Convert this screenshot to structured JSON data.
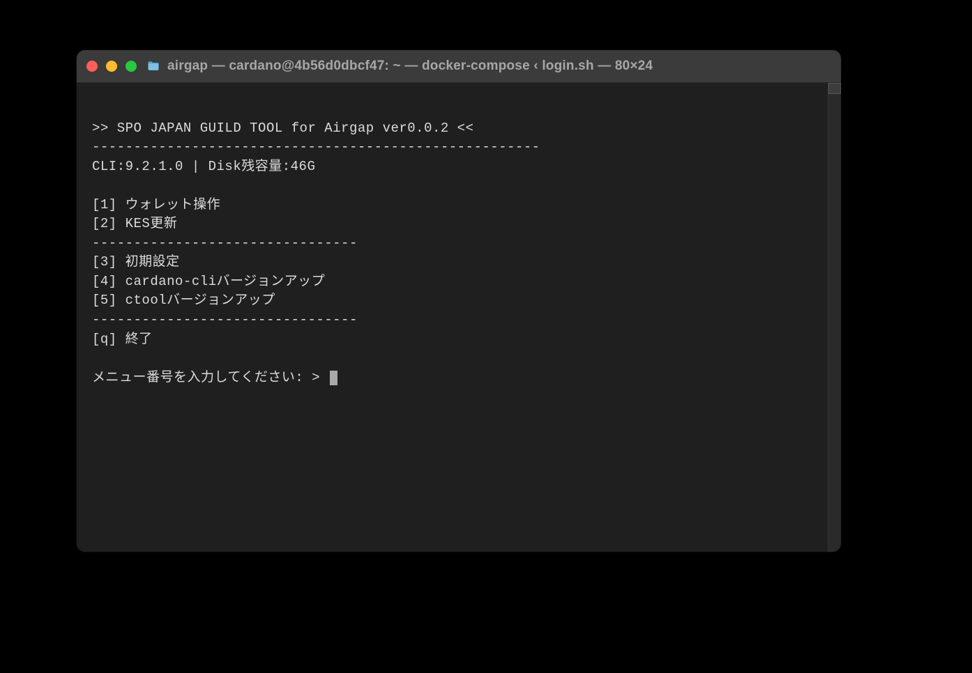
{
  "window": {
    "title": "airgap — cardano@4b56d0dbcf47: ~ — docker-compose ‹ login.sh — 80×24"
  },
  "terminal": {
    "header_line": ">> SPO JAPAN GUILD TOOL for Airgap ver0.0.2 <<",
    "rule_long": "------------------------------------------------------",
    "status_line": "CLI:9.2.1.0 | Disk残容量:46G",
    "menu": {
      "item1": "[1] ウォレット操作",
      "item2": "[2] KES更新",
      "rule_short": "--------------------------------",
      "item3": "[3] 初期設定",
      "item4": "[4] cardano-cliバージョンアップ",
      "item5": "[5] ctoolバージョンアップ",
      "itemq": "[q] 終了"
    },
    "prompt": "メニュー番号を入力してください: > "
  }
}
